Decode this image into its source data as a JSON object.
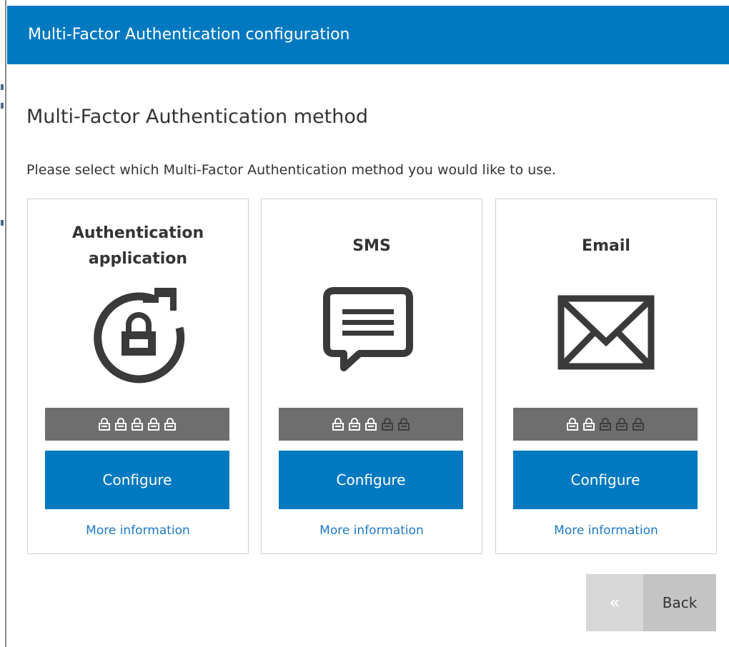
{
  "dialog": {
    "title": "Multi-Factor Authentication configuration",
    "heading": "Multi-Factor Authentication method",
    "description": "Please select which Multi-Factor Authentication method you would like to use."
  },
  "methods": [
    {
      "title_line1": "Authentication",
      "title_line2": "application",
      "icon": "rotating-lock-icon",
      "strength": 5,
      "strength_max": 5,
      "configure_label": "Configure",
      "more_label": "More information"
    },
    {
      "title_line1": "SMS",
      "icon": "chat-bubble-icon",
      "strength": 3,
      "strength_max": 5,
      "configure_label": "Configure",
      "more_label": "More information"
    },
    {
      "title_line1": "Email",
      "icon": "envelope-icon",
      "strength": 2,
      "strength_max": 5,
      "configure_label": "Configure",
      "more_label": "More information"
    }
  ],
  "footer": {
    "back_icon": "double-chevron-left-icon",
    "back_label": "Back"
  },
  "colors": {
    "accent": "#0079c1",
    "strength_bar": "#6e6e6e",
    "lock_active": "#ffffff",
    "lock_inactive": "#3e3e3e",
    "link": "#1f78c4"
  }
}
